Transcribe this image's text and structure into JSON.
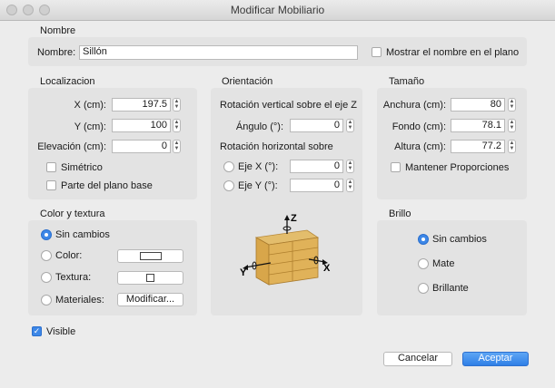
{
  "window": {
    "title": "Modificar Mobiliario"
  },
  "name_section": {
    "title": "Nombre",
    "label": "Nombre:",
    "value": "Sillón",
    "show_in_plan_label": "Mostrar el nombre en el plano",
    "show_in_plan_checked": false
  },
  "location": {
    "title": "Localizacion",
    "x_label": "X (cm):",
    "x_value": "197.5",
    "y_label": "Y (cm):",
    "y_value": "100",
    "elev_label": "Elevación (cm):",
    "elev_value": "0",
    "mirrored_label": "Simétrico",
    "base_plan_label": "Parte del plano base"
  },
  "orientation": {
    "title": "Orientación",
    "vertical_label": "Rotación vertical sobre el eje Z",
    "angle_label": "Ángulo (°):",
    "angle_value": "0",
    "horizontal_label": "Rotación horizontal sobre",
    "axis_x_label": "Eje X (°):",
    "axis_x_value": "0",
    "axis_y_label": "Eje Y (°):",
    "axis_y_value": "0",
    "axis_labels": {
      "z": "Z",
      "x": "X",
      "y": "Y"
    }
  },
  "size": {
    "title": "Tamaño",
    "width_label": "Anchura (cm):",
    "width_value": "80",
    "depth_label": "Fondo (cm):",
    "depth_value": "78.1",
    "height_label": "Altura (cm):",
    "height_value": "77.2",
    "keep_proportions_label": "Mantener Proporciones"
  },
  "color_texture": {
    "title": "Color y textura",
    "unchanged_label": "Sin cambios",
    "color_label": "Color:",
    "texture_label": "Textura:",
    "materials_label": "Materiales:",
    "modify_button": "Modificar...",
    "selected": "Sin cambios"
  },
  "brightness": {
    "title": "Brillo",
    "unchanged_label": "Sin cambios",
    "matte_label": "Mate",
    "glossy_label": "Brillante",
    "selected": "Sin cambios"
  },
  "visible": {
    "label": "Visible",
    "checked": true
  },
  "buttons": {
    "cancel": "Cancelar",
    "accept": "Aceptar"
  },
  "colors": {
    "accent": "#3d87e7",
    "window_bg": "#ececec",
    "panel_bg": "#e3e3e3"
  }
}
